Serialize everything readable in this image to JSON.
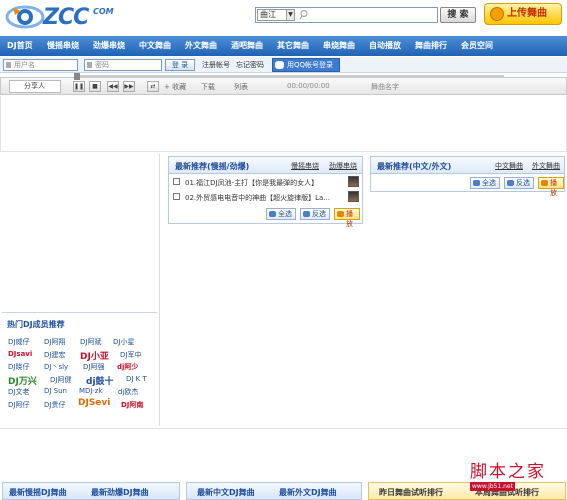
{
  "header": {
    "logo_text": "ZCC",
    "logo_suffix": "COM",
    "search_scope": "曲江",
    "search_button": "搜 索",
    "upload_button": "上传舞曲"
  },
  "nav": {
    "items": [
      "DJ首页",
      "慢摇串烧",
      "劲爆串烧",
      "中文舞曲",
      "外文舞曲",
      "酒吧舞曲",
      "其它舞曲",
      "串烧舞曲",
      "自动播放",
      "舞曲排行",
      "会员空间"
    ]
  },
  "login": {
    "username_placeholder": "用户名",
    "password_placeholder": "密码",
    "login_button": "登 录",
    "register_link": "注册帐号",
    "forgot_link": "忘记密码",
    "qq_login": "用QQ帐号登录"
  },
  "player": {
    "share": "分享人",
    "add_favorite": "+ 收藏",
    "download": "下载",
    "playlist": "列表",
    "time": "00:00/00:00",
    "track_name": "舞曲名字"
  },
  "hot_djs": {
    "title": "热门DJ成员推荐",
    "rows": [
      [
        "DJ威仔",
        "DJ阿翔",
        "DJ阿斌",
        "DJ小星"
      ],
      [
        "DJsavi",
        "DJ建宏",
        "DJ小亚",
        "DJ军中"
      ],
      [
        "DJ晓仔",
        "DJ丶sly",
        "DJ阿强",
        "dj阿少"
      ],
      [
        "DJ万兴",
        "DJ阿健",
        "dj鼓十",
        "DJ K T"
      ],
      [
        "DJ文老",
        "DJ Sun",
        "MDJ-zk",
        "dj欧杰"
      ],
      [
        "DJ阿仔",
        "DJ贵仔",
        "DJSevi",
        "DJ阿南"
      ]
    ]
  },
  "panel_cn": {
    "title": "最新推荐(慢摇/劲爆)",
    "link_more_slow": "慢摇串烧",
    "link_more_fast": "劲爆串烧",
    "songs": [
      "01.福江DJ凤池-主打【你是我最弹的女人】",
      "02.外贸感电电音中的神曲【超火旋律版】La..."
    ],
    "select_all": "全选",
    "invert": "反选",
    "play": "播放"
  },
  "panel_foreign": {
    "title": "最新推荐(中文/外文)",
    "link_cn": "中文舞曲",
    "link_foreign": "外文舞曲",
    "select_all": "全选",
    "invert": "反选",
    "play": "播放"
  },
  "bottom_tabs": {
    "tab1": "最新慢摇DJ舞曲",
    "tab2": "最新劲爆DJ舞曲",
    "tab3": "最新中文DJ舞曲",
    "tab4": "最新外文DJ舞曲",
    "tab5": "昨日舞曲试听排行",
    "tab6": "本周舞曲试听排行"
  },
  "watermark": {
    "big": "脚本之家",
    "small": "www.jb51.net"
  },
  "colors": {
    "brand_blue": "#1f63b5",
    "title_blue": "#1f4e9b",
    "accent_red": "#c8102e",
    "upload_yellow": "#ffc400"
  }
}
